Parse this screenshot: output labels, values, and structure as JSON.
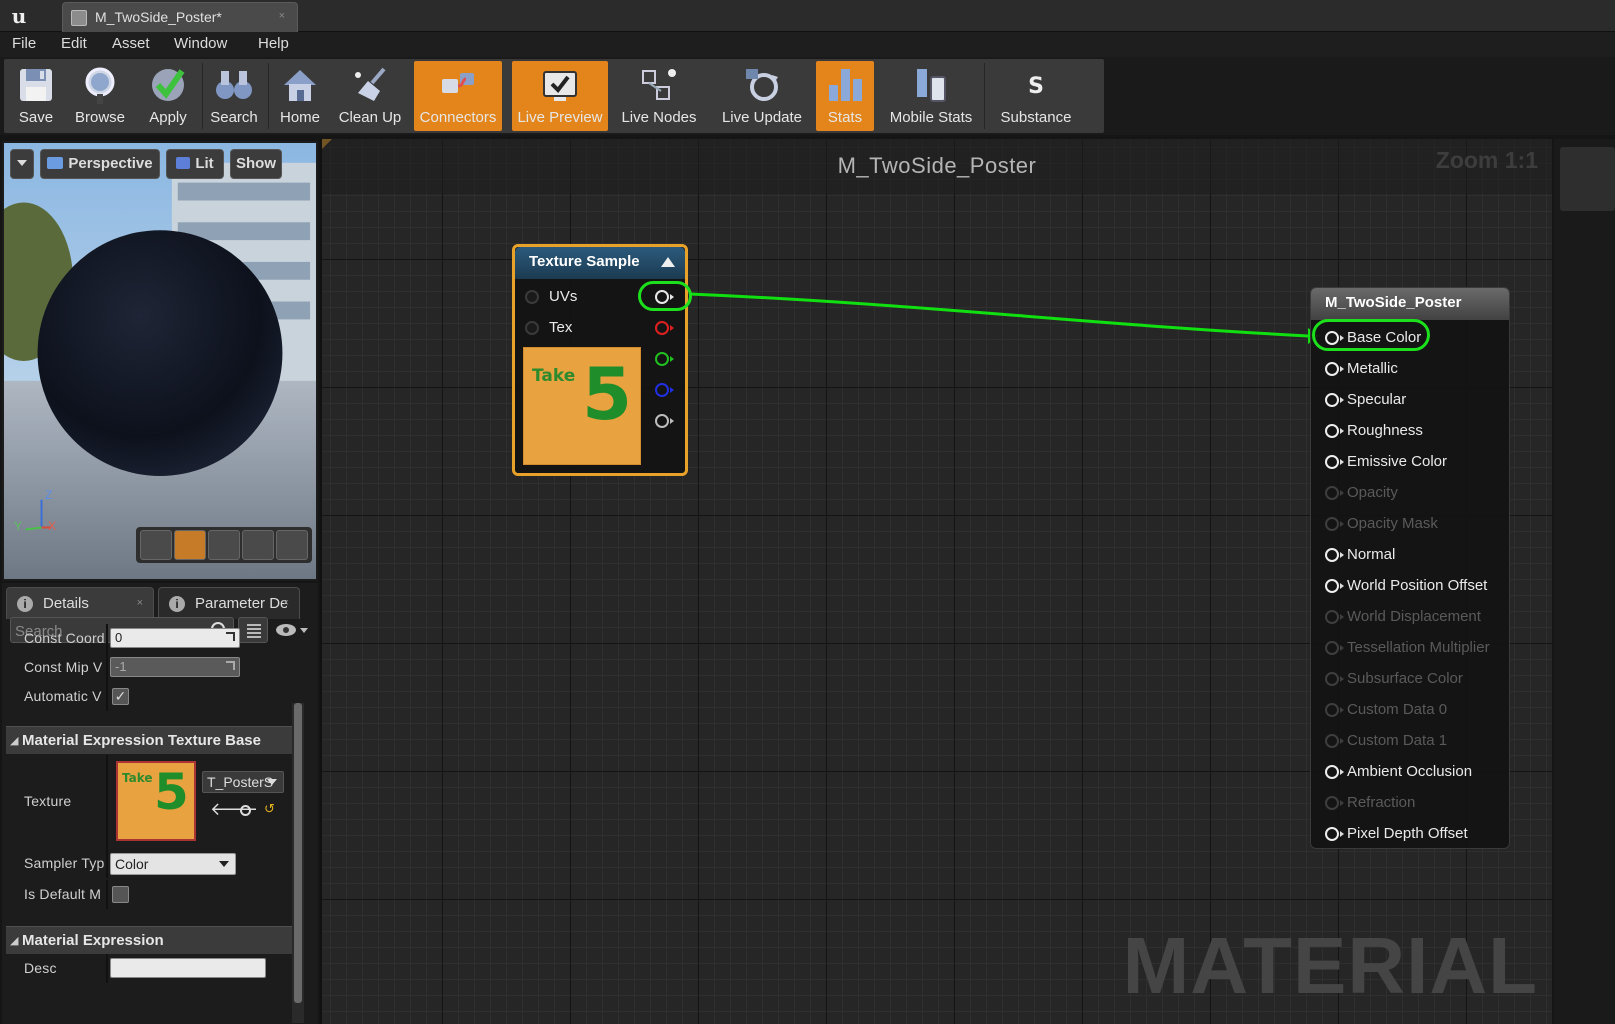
{
  "window": {
    "tab_title": "M_TwoSide_Poster*",
    "tab_close": "×"
  },
  "menu": [
    "File",
    "Edit",
    "Asset",
    "Window",
    "Help"
  ],
  "toolbar": [
    {
      "label": "Save",
      "icon": "floppy-icon",
      "active": false
    },
    {
      "label": "Browse",
      "icon": "magnifier-icon",
      "active": false
    },
    {
      "label": "Apply",
      "icon": "checkmark-icon",
      "active": false
    },
    {
      "label": "Search",
      "icon": "binoculars-icon",
      "active": false
    },
    {
      "label": "Home",
      "icon": "house-icon",
      "active": false
    },
    {
      "label": "Clean Up",
      "icon": "broom-icon",
      "active": false
    },
    {
      "label": "Connectors",
      "icon": "connectors-icon",
      "active": true
    },
    {
      "label": "Live Preview",
      "icon": "monitor-icon",
      "active": true
    },
    {
      "label": "Live Nodes",
      "icon": "nodes-icon",
      "active": false
    },
    {
      "label": "Live Update",
      "icon": "refresh-icon",
      "active": false
    },
    {
      "label": "Stats",
      "icon": "bar-chart-icon",
      "active": true
    },
    {
      "label": "Mobile Stats",
      "icon": "mobile-icon",
      "active": false
    },
    {
      "label": "Substance",
      "icon": "substance-icon",
      "active": false
    }
  ],
  "viewport": {
    "perspective": "Perspective",
    "lit": "Lit",
    "show": "Show",
    "axis_z": "Z",
    "axis_x": "X",
    "axis_y": "Y"
  },
  "details": {
    "tab_details": "Details",
    "tab_params": "Parameter De",
    "tab_close": "×",
    "search_placeholder": "Search",
    "props_top": [
      {
        "label": "Const Coordi",
        "value": "0"
      },
      {
        "label": "Const Mip V",
        "value": "-1"
      },
      {
        "label": "Automatic V",
        "checked": true
      }
    ],
    "section_texture_base": "Material Expression Texture Base",
    "texture_label": "Texture",
    "texture_asset": "T_PosterS",
    "sampler_label": "Sampler Typ",
    "sampler_value": "Color",
    "is_default_label": "Is Default M",
    "section_expression": "Material Expression",
    "desc_label": "Desc",
    "desc_value": ""
  },
  "poster": {
    "take": "Take",
    "number": "5"
  },
  "graph": {
    "title": "M_TwoSide_Poster",
    "zoom": "Zoom 1:1",
    "watermark": "MATERIAL",
    "connection_color": "#10e010",
    "texture_node": {
      "title": "Texture Sample",
      "inputs": [
        "UVs",
        "Tex"
      ],
      "output_colors": [
        "#e8e8e8",
        "#e02020",
        "#20c020",
        "#2030e0",
        "#bdbdbd"
      ]
    },
    "material_node": {
      "title": "M_TwoSide_Poster",
      "inputs": [
        {
          "label": "Base Color",
          "enabled": true
        },
        {
          "label": "Metallic",
          "enabled": true
        },
        {
          "label": "Specular",
          "enabled": true
        },
        {
          "label": "Roughness",
          "enabled": true
        },
        {
          "label": "Emissive Color",
          "enabled": true
        },
        {
          "label": "Opacity",
          "enabled": false
        },
        {
          "label": "Opacity Mask",
          "enabled": false
        },
        {
          "label": "Normal",
          "enabled": true
        },
        {
          "label": "World Position Offset",
          "enabled": true
        },
        {
          "label": "World Displacement",
          "enabled": false
        },
        {
          "label": "Tessellation Multiplier",
          "enabled": false
        },
        {
          "label": "Subsurface Color",
          "enabled": false
        },
        {
          "label": "Custom Data 0",
          "enabled": false
        },
        {
          "label": "Custom Data 1",
          "enabled": false
        },
        {
          "label": "Ambient Occlusion",
          "enabled": true
        },
        {
          "label": "Refraction",
          "enabled": false
        },
        {
          "label": "Pixel Depth Offset",
          "enabled": true
        }
      ]
    }
  }
}
